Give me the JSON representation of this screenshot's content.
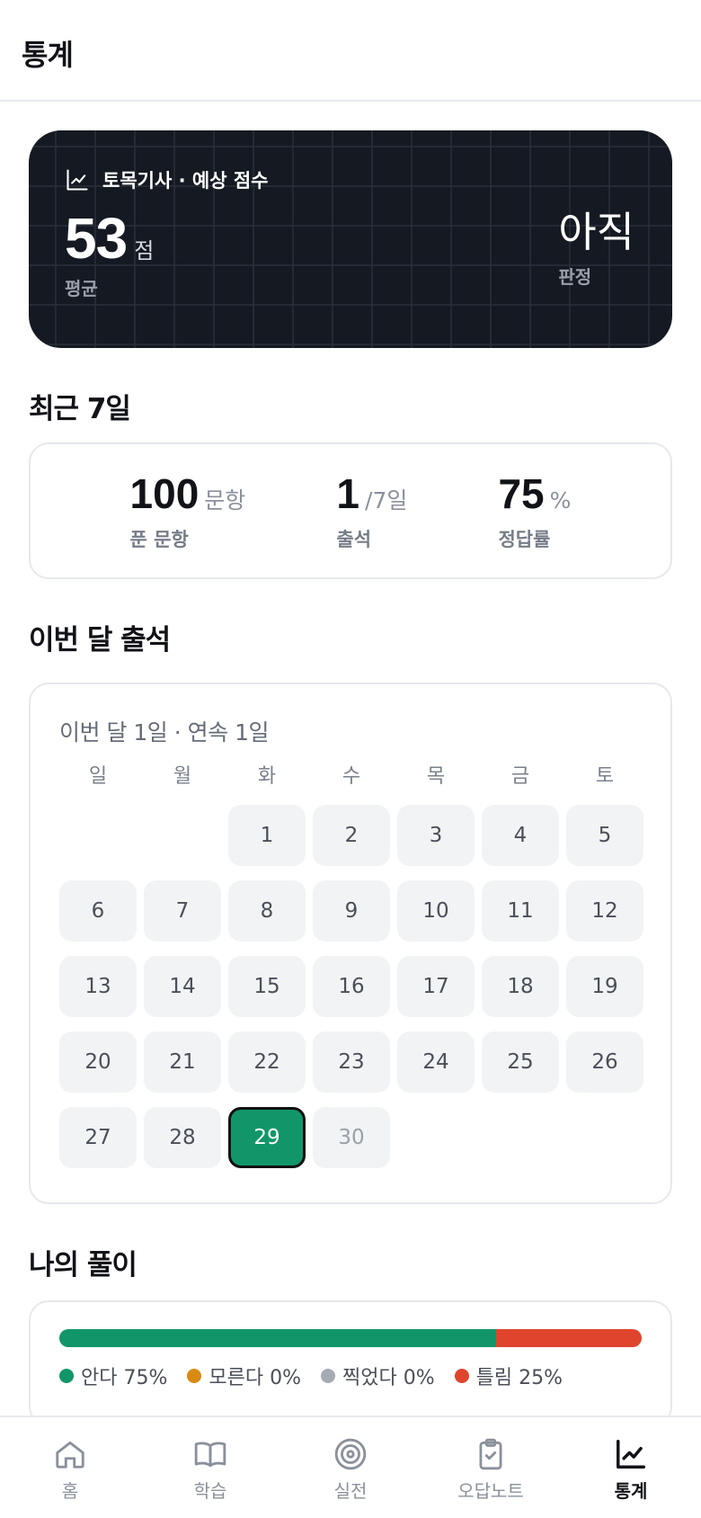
{
  "header": {
    "title": "통계"
  },
  "hero": {
    "icon": "line-chart-icon",
    "title": "토목기사 · 예상 점수",
    "score": "53",
    "score_unit": "점",
    "score_label": "평균",
    "verdict": "아직",
    "verdict_label": "판정",
    "background": "#151922"
  },
  "recent": {
    "title": "최근 7일",
    "stats": [
      {
        "value": "100",
        "unit": "문항",
        "label": "푼 문항"
      },
      {
        "value": "1",
        "unit": "/7일",
        "label": "출석"
      },
      {
        "value": "75",
        "unit": "%",
        "label": "정답률"
      }
    ]
  },
  "attendance": {
    "title": "이번 달 출석",
    "summary": "이번 달 1일 · 연속 1일",
    "weekdays": [
      "일",
      "월",
      "화",
      "수",
      "목",
      "금",
      "토"
    ],
    "leading_blanks": 2,
    "days_in_month": 30,
    "today": 29,
    "attended": [
      29
    ],
    "accent": "#129669"
  },
  "solve": {
    "title": "나의 풀이",
    "segments": [
      {
        "label": "안다 75%",
        "fraction": 0.75,
        "color": "#129669"
      },
      {
        "label": "모른다 0%",
        "fraction": 0,
        "color": "#d98a12"
      },
      {
        "label": "찍었다 0%",
        "fraction": 0,
        "color": "#a5aab5"
      },
      {
        "label": "틀림 25%",
        "fraction": 0.25,
        "color": "#e0442c"
      }
    ]
  },
  "tabs": [
    {
      "label": "홈",
      "icon": "home-icon",
      "active": false
    },
    {
      "label": "학습",
      "icon": "book-icon",
      "active": false
    },
    {
      "label": "실전",
      "icon": "target-icon",
      "active": false
    },
    {
      "label": "오답노트",
      "icon": "clipboard-check-icon",
      "active": false
    },
    {
      "label": "통계",
      "icon": "line-chart-icon",
      "active": true
    }
  ]
}
